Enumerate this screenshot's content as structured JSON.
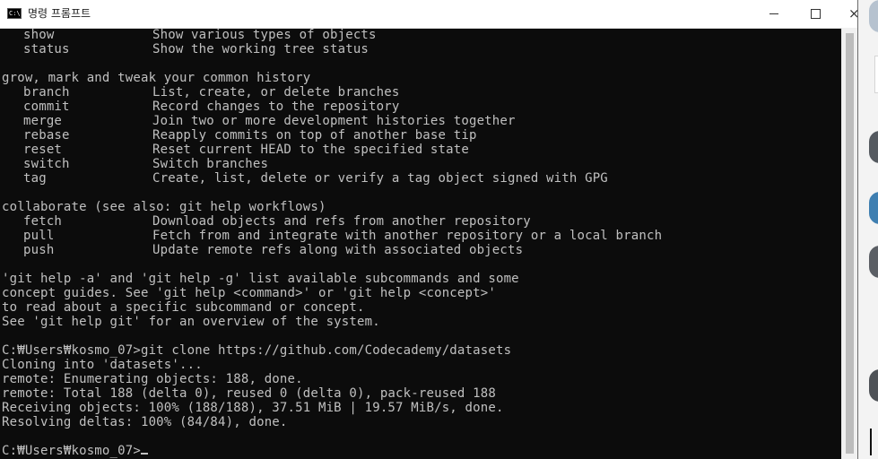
{
  "window": {
    "title": "명령 프롬프트",
    "icon_label": "C:\\",
    "minimize_icon": "minimize-icon",
    "maximize_icon": "maximize-icon",
    "close_label": "×"
  },
  "console": {
    "lines": [
      {
        "cmd": "show",
        "desc": "Show various types of objects"
      },
      {
        "cmd": "status",
        "desc": "Show the working tree status"
      },
      {
        "text": ""
      },
      {
        "text": "grow, mark and tweak your common history"
      },
      {
        "cmd": "branch",
        "desc": "List, create, or delete branches"
      },
      {
        "cmd": "commit",
        "desc": "Record changes to the repository"
      },
      {
        "cmd": "merge",
        "desc": "Join two or more development histories together"
      },
      {
        "cmd": "rebase",
        "desc": "Reapply commits on top of another base tip"
      },
      {
        "cmd": "reset",
        "desc": "Reset current HEAD to the specified state"
      },
      {
        "cmd": "switch",
        "desc": "Switch branches"
      },
      {
        "cmd": "tag",
        "desc": "Create, list, delete or verify a tag object signed with GPG"
      },
      {
        "text": ""
      },
      {
        "text": "collaborate (see also: git help workflows)"
      },
      {
        "cmd": "fetch",
        "desc": "Download objects and refs from another repository"
      },
      {
        "cmd": "pull",
        "desc": "Fetch from and integrate with another repository or a local branch"
      },
      {
        "cmd": "push",
        "desc": "Update remote refs along with associated objects"
      },
      {
        "text": ""
      },
      {
        "text": "'git help -a' and 'git help -g' list available subcommands and some"
      },
      {
        "text": "concept guides. See 'git help <command>' or 'git help <concept>'"
      },
      {
        "text": "to read about a specific subcommand or concept."
      },
      {
        "text": "See 'git help git' for an overview of the system."
      },
      {
        "text": ""
      },
      {
        "text": "C:₩Users₩kosmo_07>git clone https://github.com/Codecademy/datasets"
      },
      {
        "text": "Cloning into 'datasets'..."
      },
      {
        "text": "remote: Enumerating objects: 188, done."
      },
      {
        "text": "remote: Total 188 (delta 0), reused 0 (delta 0), pack-reused 188"
      },
      {
        "text": "Receiving objects: 100% (188/188), 37.51 MiB | 19.57 MiB/s, done."
      },
      {
        "text": "Resolving deltas: 100% (84/84), done."
      },
      {
        "text": ""
      },
      {
        "text": "C:₩Users₩kosmo_07>",
        "prompt": true
      }
    ]
  },
  "colors": {
    "console_bg": "#0c0c0c",
    "console_fg": "#c0c0c0",
    "titlebar_bg": "#ffffff"
  }
}
